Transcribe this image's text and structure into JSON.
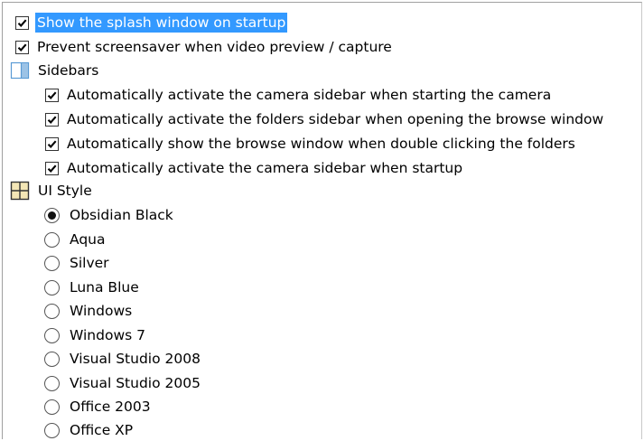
{
  "colors": {
    "selection": "#3399ff",
    "icon_blue": "#5a9bd5"
  },
  "top_options": [
    {
      "label": "Show the splash window on startup",
      "checked": true,
      "selected": true
    },
    {
      "label": "Prevent screensaver when video preview / capture",
      "checked": true,
      "selected": false
    }
  ],
  "sidebars": {
    "icon": "sidebar-panel-icon",
    "label": "Sidebars",
    "items": [
      {
        "label": "Automatically activate the camera sidebar when starting the camera",
        "checked": true
      },
      {
        "label": "Automatically activate the folders sidebar when opening the browse window",
        "checked": true
      },
      {
        "label": "Automatically show the browse window when double clicking the folders",
        "checked": true
      },
      {
        "label": "Automatically activate the camera sidebar when startup",
        "checked": true
      }
    ]
  },
  "ui_style": {
    "icon": "grid-layout-icon",
    "label": "UI Style",
    "selected": "Obsidian Black",
    "options": [
      {
        "label": "Obsidian Black"
      },
      {
        "label": "Aqua"
      },
      {
        "label": "Silver"
      },
      {
        "label": "Luna Blue"
      },
      {
        "label": "Windows"
      },
      {
        "label": "Windows 7"
      },
      {
        "label": "Visual Studio 2008"
      },
      {
        "label": "Visual Studio 2005"
      },
      {
        "label": "Office 2003"
      },
      {
        "label": "Office XP"
      }
    ]
  }
}
